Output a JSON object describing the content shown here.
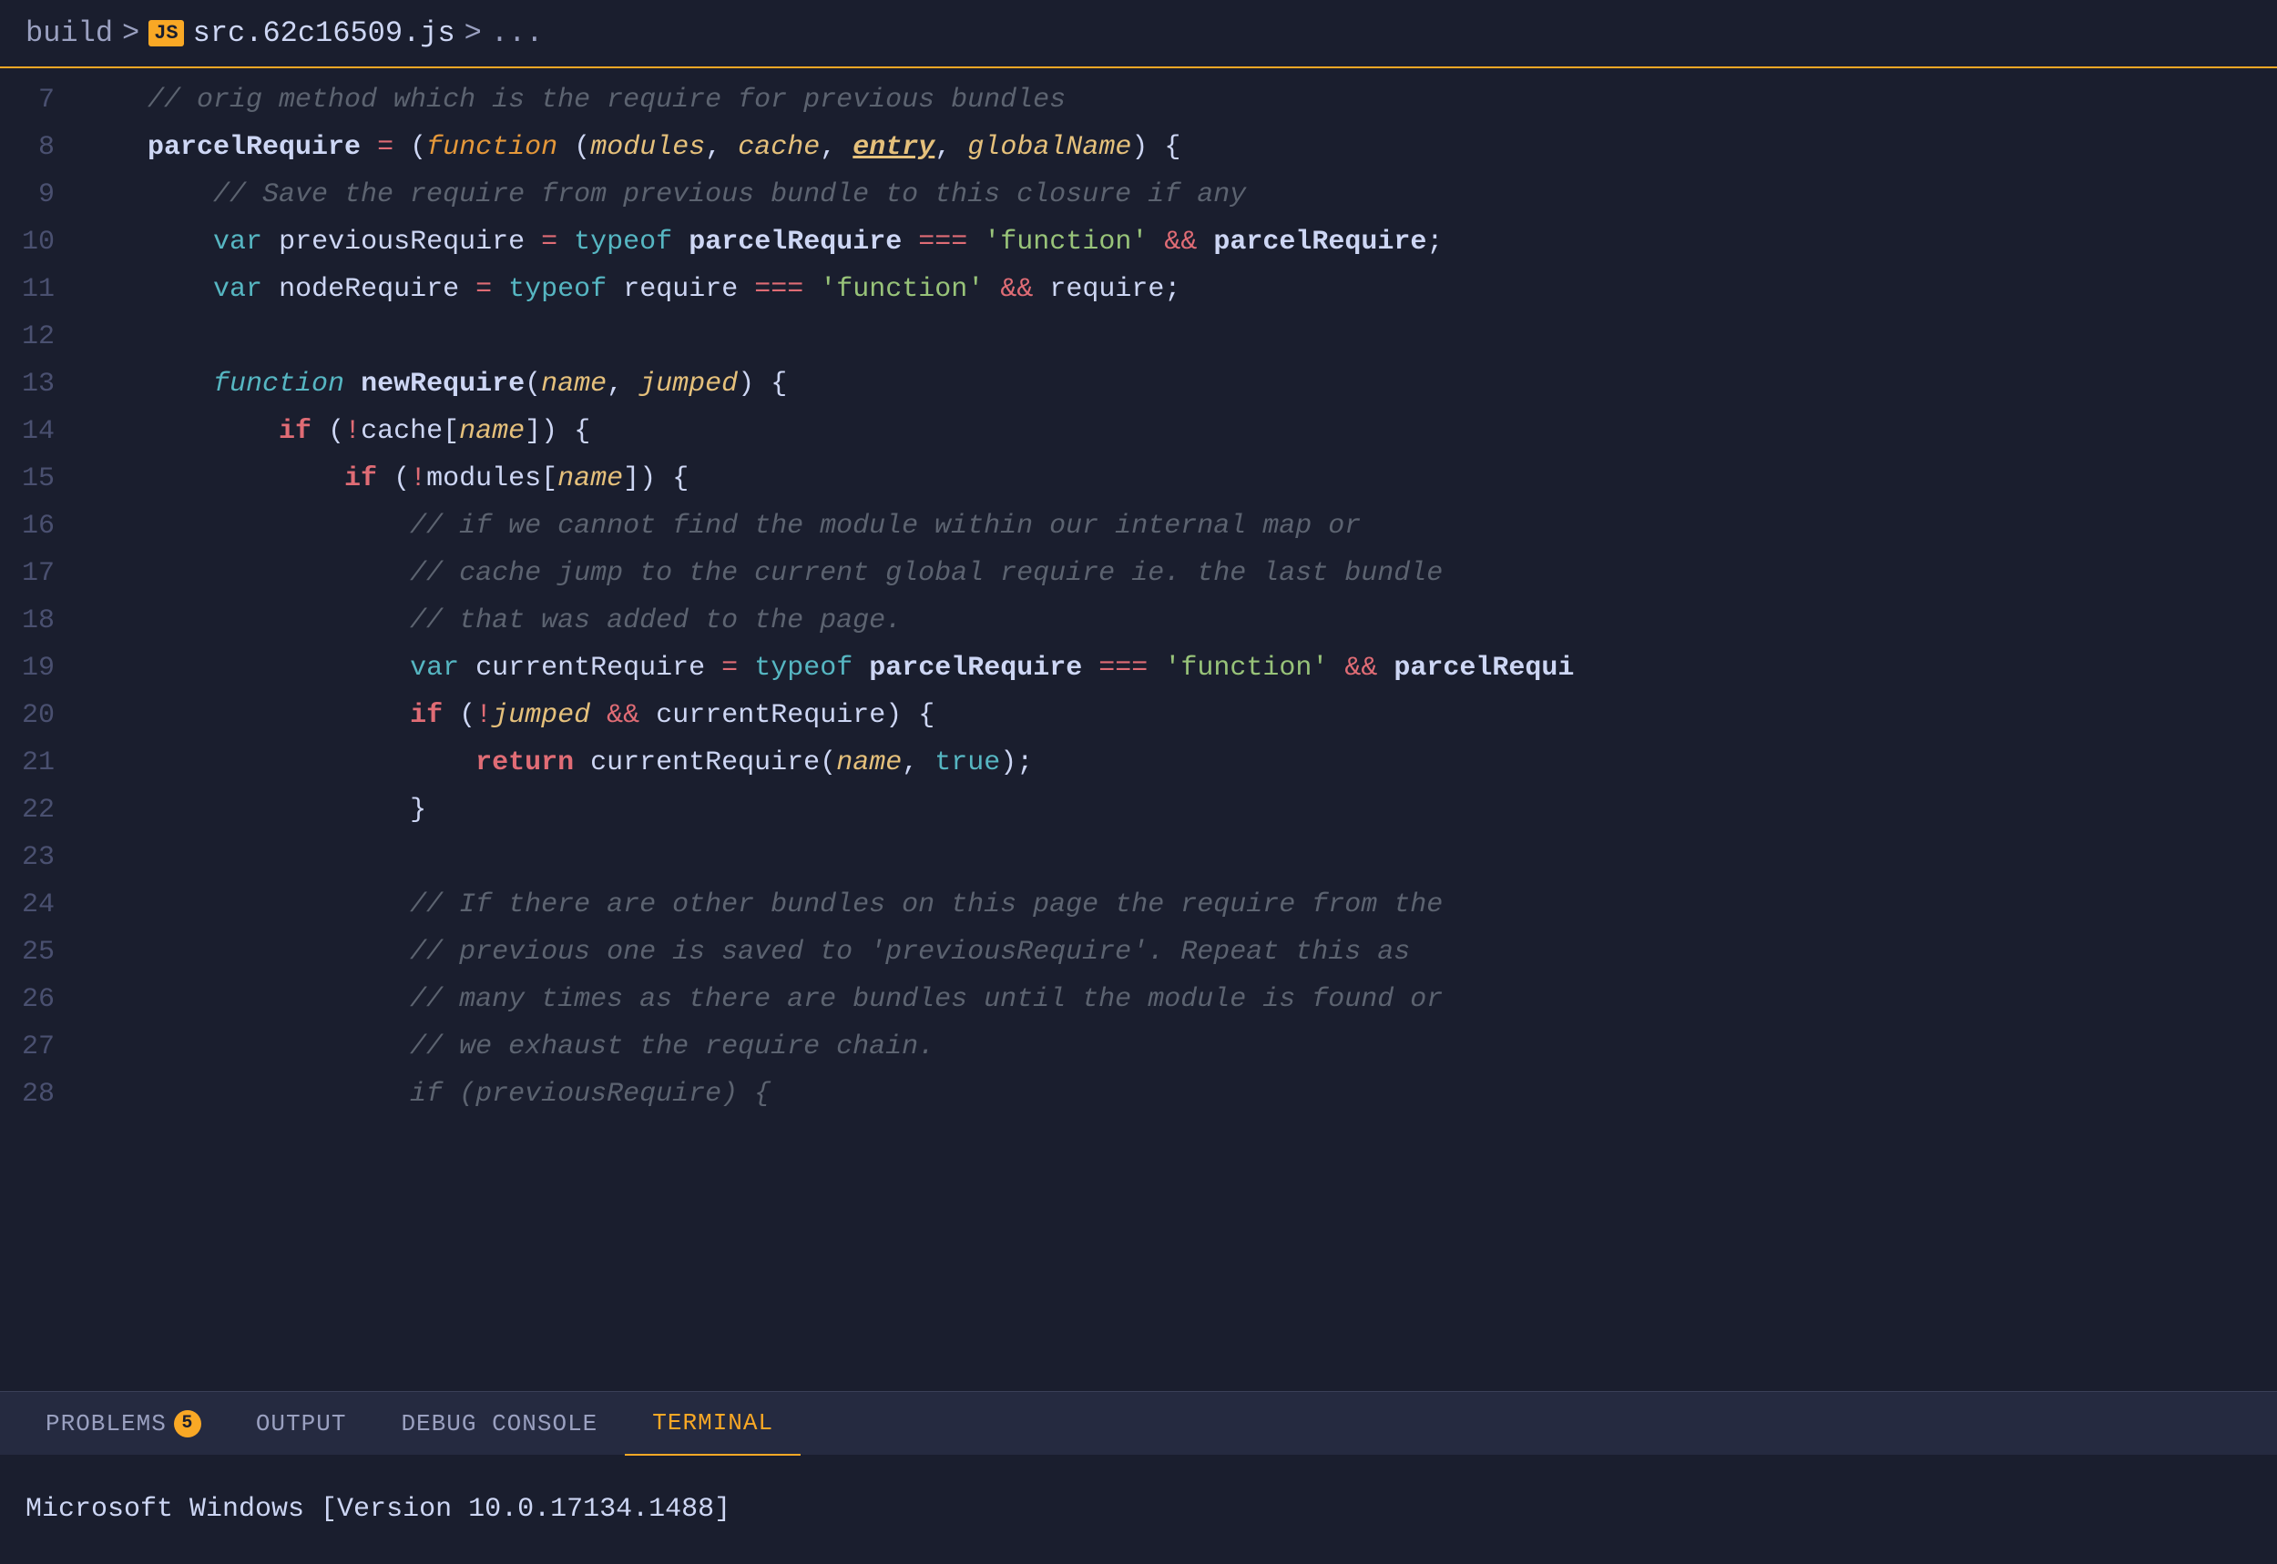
{
  "breadcrumb": {
    "build": "build",
    "separator1": ">",
    "js_icon": "JS",
    "filename": "src.62c16509.js",
    "separator2": ">",
    "ellipsis": "..."
  },
  "code": {
    "lines": [
      {
        "num": "7",
        "content": "comment_orig"
      },
      {
        "num": "8",
        "content": "parcel_assign"
      },
      {
        "num": "9",
        "content": "comment_save"
      },
      {
        "num": "10",
        "content": "var_previous"
      },
      {
        "num": "11",
        "content": "var_node"
      },
      {
        "num": "12",
        "content": "empty"
      },
      {
        "num": "13",
        "content": "func_newrequire"
      },
      {
        "num": "14",
        "content": "if_cache"
      },
      {
        "num": "15",
        "content": "if_modules"
      },
      {
        "num": "16",
        "content": "comment16"
      },
      {
        "num": "17",
        "content": "comment17"
      },
      {
        "num": "18",
        "content": "comment18"
      },
      {
        "num": "19",
        "content": "var_current"
      },
      {
        "num": "20",
        "content": "if_jumped"
      },
      {
        "num": "21",
        "content": "return_current"
      },
      {
        "num": "22",
        "content": "close_brace2"
      },
      {
        "num": "23",
        "content": "empty"
      },
      {
        "num": "24",
        "content": "comment24"
      },
      {
        "num": "25",
        "content": "comment25"
      },
      {
        "num": "26",
        "content": "comment26"
      },
      {
        "num": "27",
        "content": "comment27"
      },
      {
        "num": "28",
        "content": "if_prev_partial"
      }
    ]
  },
  "panel": {
    "tabs": [
      {
        "id": "problems",
        "label": "PROBLEMS",
        "badge": "5",
        "active": false
      },
      {
        "id": "output",
        "label": "OUTPUT",
        "active": false
      },
      {
        "id": "debug",
        "label": "DEBUG CONSOLE",
        "active": false
      },
      {
        "id": "terminal",
        "label": "TERMINAL",
        "active": true
      }
    ],
    "terminal_line": "Microsoft Windows [Version 10.0.17134.1488]"
  }
}
